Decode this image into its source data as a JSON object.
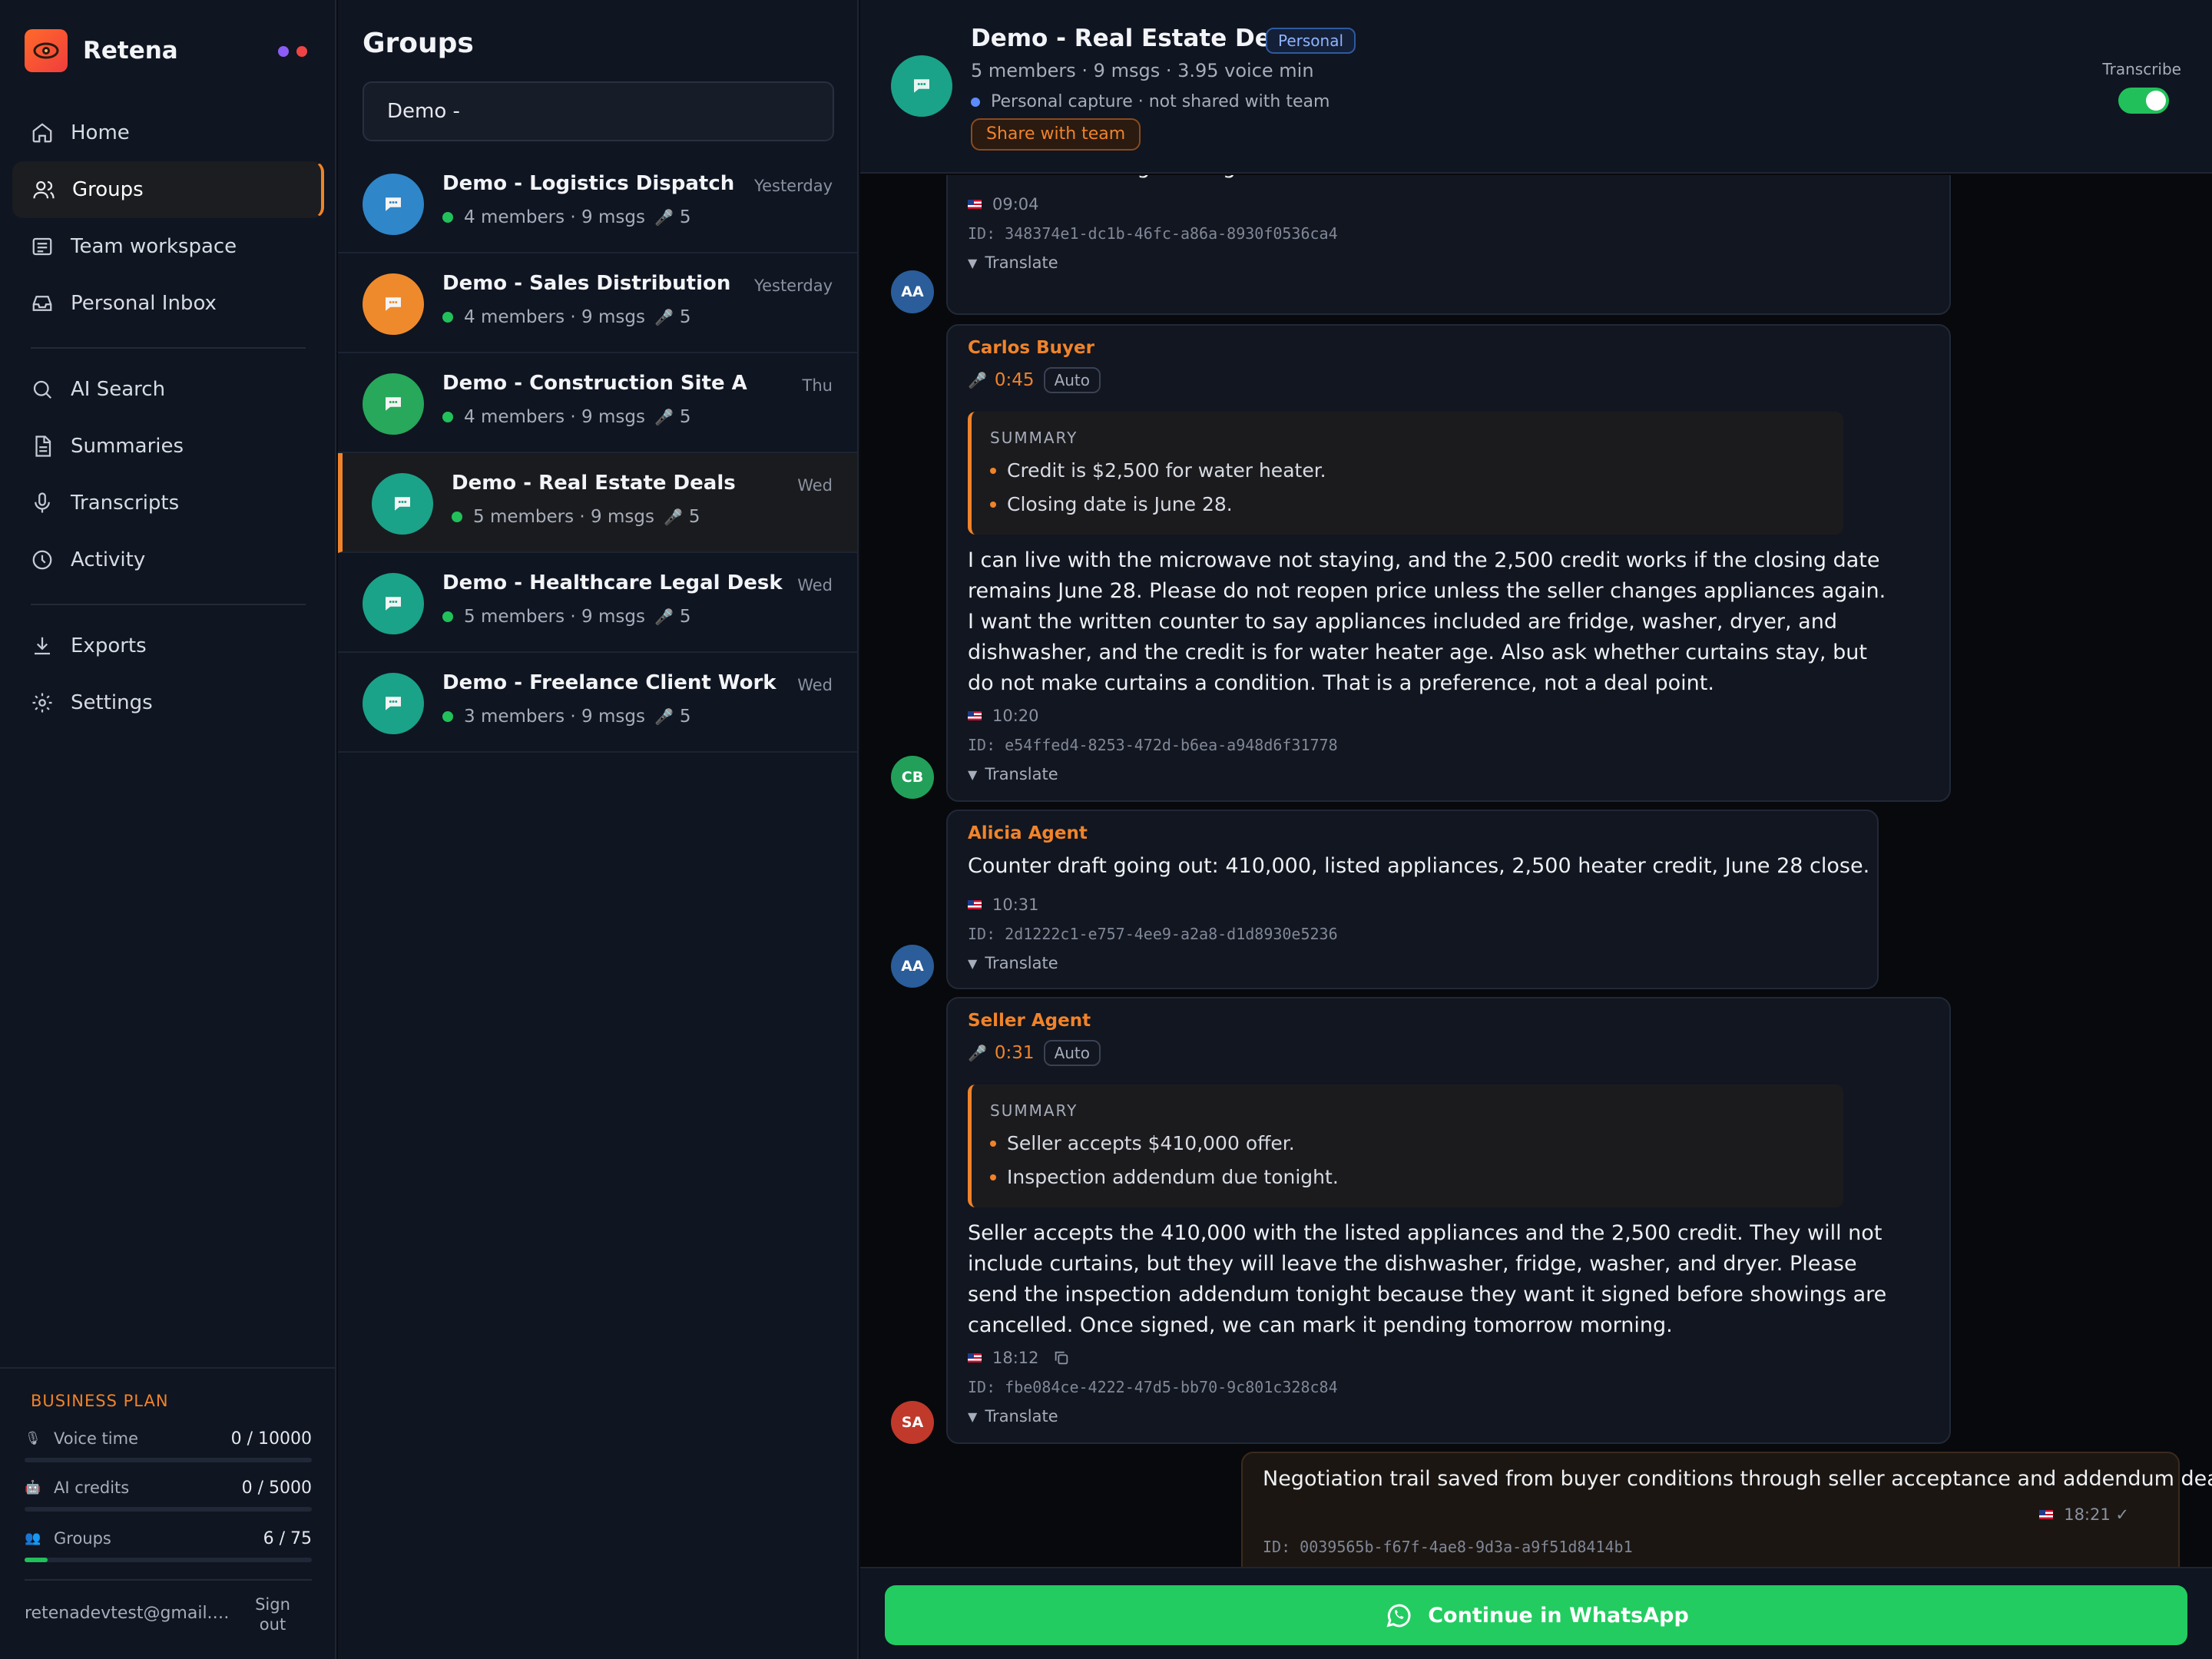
{
  "brand": {
    "name": "Retena"
  },
  "status_dots": [
    {
      "color": "#8b5cf6"
    },
    {
      "color": "#ef4444"
    }
  ],
  "nav": {
    "items": [
      {
        "label": "Home",
        "icon": "home-icon"
      },
      {
        "label": "Groups",
        "icon": "users-icon",
        "active": true
      },
      {
        "label": "Team workspace",
        "icon": "workspace-icon"
      },
      {
        "label": "Personal Inbox",
        "icon": "inbox-icon"
      },
      {
        "label": "AI Search",
        "icon": "search-icon"
      },
      {
        "label": "Summaries",
        "icon": "document-icon"
      },
      {
        "label": "Transcripts",
        "icon": "microphone-icon"
      },
      {
        "label": "Activity",
        "icon": "clock-icon"
      },
      {
        "label": "Exports",
        "icon": "download-icon"
      },
      {
        "label": "Settings",
        "icon": "gear-icon"
      }
    ]
  },
  "plan": {
    "title": "BUSINESS PLAN",
    "usage": [
      {
        "label": "Voice time",
        "value": "0 / 10000",
        "icon": "mic-emoji-icon",
        "fraction": 0.0
      },
      {
        "label": "AI credits",
        "value": "0 / 5000",
        "icon": "robot-emoji-icon",
        "fraction": 0.0
      },
      {
        "label": "Groups",
        "value": "6 / 75",
        "icon": "people-emoji-icon",
        "fraction": 0.08
      }
    ],
    "email": "retenadevtest@gmail.com",
    "signout_label": "Sign out"
  },
  "groups": {
    "title": "Groups",
    "search_value": "Demo -",
    "items": [
      {
        "name": "Demo - Logistics Dispatch",
        "time": "Yesterday",
        "meta": "4 members · 9 msgs",
        "voice": "5",
        "color": "#2f86c9"
      },
      {
        "name": "Demo - Sales Distribution",
        "time": "Yesterday",
        "meta": "4 members · 9 msgs",
        "voice": "5",
        "color": "#ef8a2c"
      },
      {
        "name": "Demo - Construction Site A",
        "time": "Thu",
        "meta": "4 members · 9 msgs",
        "voice": "5",
        "color": "#27a85a"
      },
      {
        "name": "Demo - Real Estate Deals",
        "time": "Wed",
        "meta": "5 members · 9 msgs",
        "voice": "5",
        "color": "#1aa389",
        "active": true
      },
      {
        "name": "Demo - Healthcare Legal Desk",
        "time": "Wed",
        "meta": "5 members · 9 msgs",
        "voice": "5",
        "color": "#1aa389"
      },
      {
        "name": "Demo - Freelance Client Work",
        "time": "Wed",
        "meta": "3 members · 9 msgs",
        "voice": "5",
        "color": "#1aa389"
      }
    ]
  },
  "chat": {
    "title": "Demo - Real Estate Deals",
    "badge": "Personal",
    "meta": "5 members · 9 msgs · 3.95 voice min",
    "capture_note": "Personal capture · not shared with team",
    "share_label": "Share with team",
    "transcribe_label": "Transcribe",
    "transcribe_on": true,
    "messages": [
      {
        "initials": "AA",
        "avatar_color": "#2a5d9a",
        "body": "continue showings through the weekend.",
        "time": "09:04",
        "id": "ID: 348374e1-dc1b-46fc-a86a-8930f0536ca4",
        "translate": "Translate"
      },
      {
        "initials": "CB",
        "avatar_color": "#22a05a",
        "sender": "Carlos Buyer",
        "duration": "0:45",
        "auto": "Auto",
        "summary_label": "SUMMARY",
        "summary": [
          "Credit is $2,500 for water heater.",
          "Closing date is June 28."
        ],
        "body": "I can live with the microwave not staying, and the 2,500 credit works if the closing date remains June 28. Please do not reopen price unless the seller changes appliances again. I want the written counter to say appliances included are fridge, washer, dryer, and dishwasher, and the credit is for water heater age. Also ask whether curtains stay, but do not make curtains a condition. That is a preference, not a deal point.",
        "time": "10:20",
        "id": "ID: e54ffed4-8253-472d-b6ea-a948d6f31778",
        "translate": "Translate"
      },
      {
        "initials": "AA",
        "avatar_color": "#2a5d9a",
        "sender": "Alicia Agent",
        "body": "Counter draft going out: 410,000, listed appliances, 2,500 heater credit, June 28 close.",
        "time": "10:31",
        "id": "ID: 2d1222c1-e757-4ee9-a2a8-d1d8930e5236",
        "translate": "Translate"
      },
      {
        "initials": "SA",
        "avatar_color": "#c0392b",
        "sender": "Seller Agent",
        "duration": "0:31",
        "auto": "Auto",
        "summary_label": "SUMMARY",
        "summary": [
          "Seller accepts $410,000 offer.",
          "Inspection addendum due tonight."
        ],
        "body": "Seller accepts the 410,000 with the listed appliances and the 2,500 credit. They will not include curtains, but they will leave the dishwasher, fridge, washer, and dryer. Please send the inspection addendum tonight because they want it signed before showings are cancelled. Once signed, we can mark it pending tomorrow morning.",
        "time": "18:12",
        "id": "ID: fbe084ce-4222-47d5-bb70-9c801c328c84",
        "translate": "Translate"
      },
      {
        "outgoing": true,
        "body": "Negotiation trail saved from buyer conditions through seller acceptance and addendum deadline.",
        "time": "18:21 ✓",
        "id": "ID: 0039565b-f67f-4ae8-9d3a-a9f51d8414b1"
      }
    ],
    "whatsapp_label": "Continue in WhatsApp"
  }
}
